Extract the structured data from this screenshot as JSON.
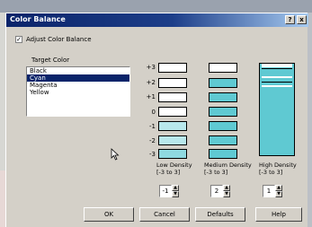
{
  "dialog": {
    "title": "Color Balance",
    "help_label": "?",
    "close_label": "x"
  },
  "adjust": {
    "label": "Adjust Color Balance",
    "checked": true,
    "check_glyph": "✓"
  },
  "target": {
    "label": "Target Color",
    "items": [
      "Black",
      "Cyan",
      "Magenta",
      "Yellow"
    ],
    "selected": "Cyan"
  },
  "rows": [
    "+3",
    "+2",
    "+1",
    "0",
    "-1",
    "-2",
    "-3"
  ],
  "columns": [
    {
      "line1": "Low Density",
      "line2": "[-3 to 3]",
      "value": "-1"
    },
    {
      "line1": "Medium Density",
      "line2": "[-3 to 3]",
      "value": "2"
    },
    {
      "line1": "High Density",
      "line2": "[-3 to 3]",
      "value": "1"
    }
  ],
  "buttons": {
    "ok": "OK",
    "cancel": "Cancel",
    "defaults": "Defaults",
    "help": "Help"
  },
  "colors": {
    "title_bar": "#0a246a",
    "selection": "#0a246a",
    "cyan": "#5fc9d2",
    "light_cyan": "#b8e8ec",
    "face": "#d4d0c8"
  }
}
